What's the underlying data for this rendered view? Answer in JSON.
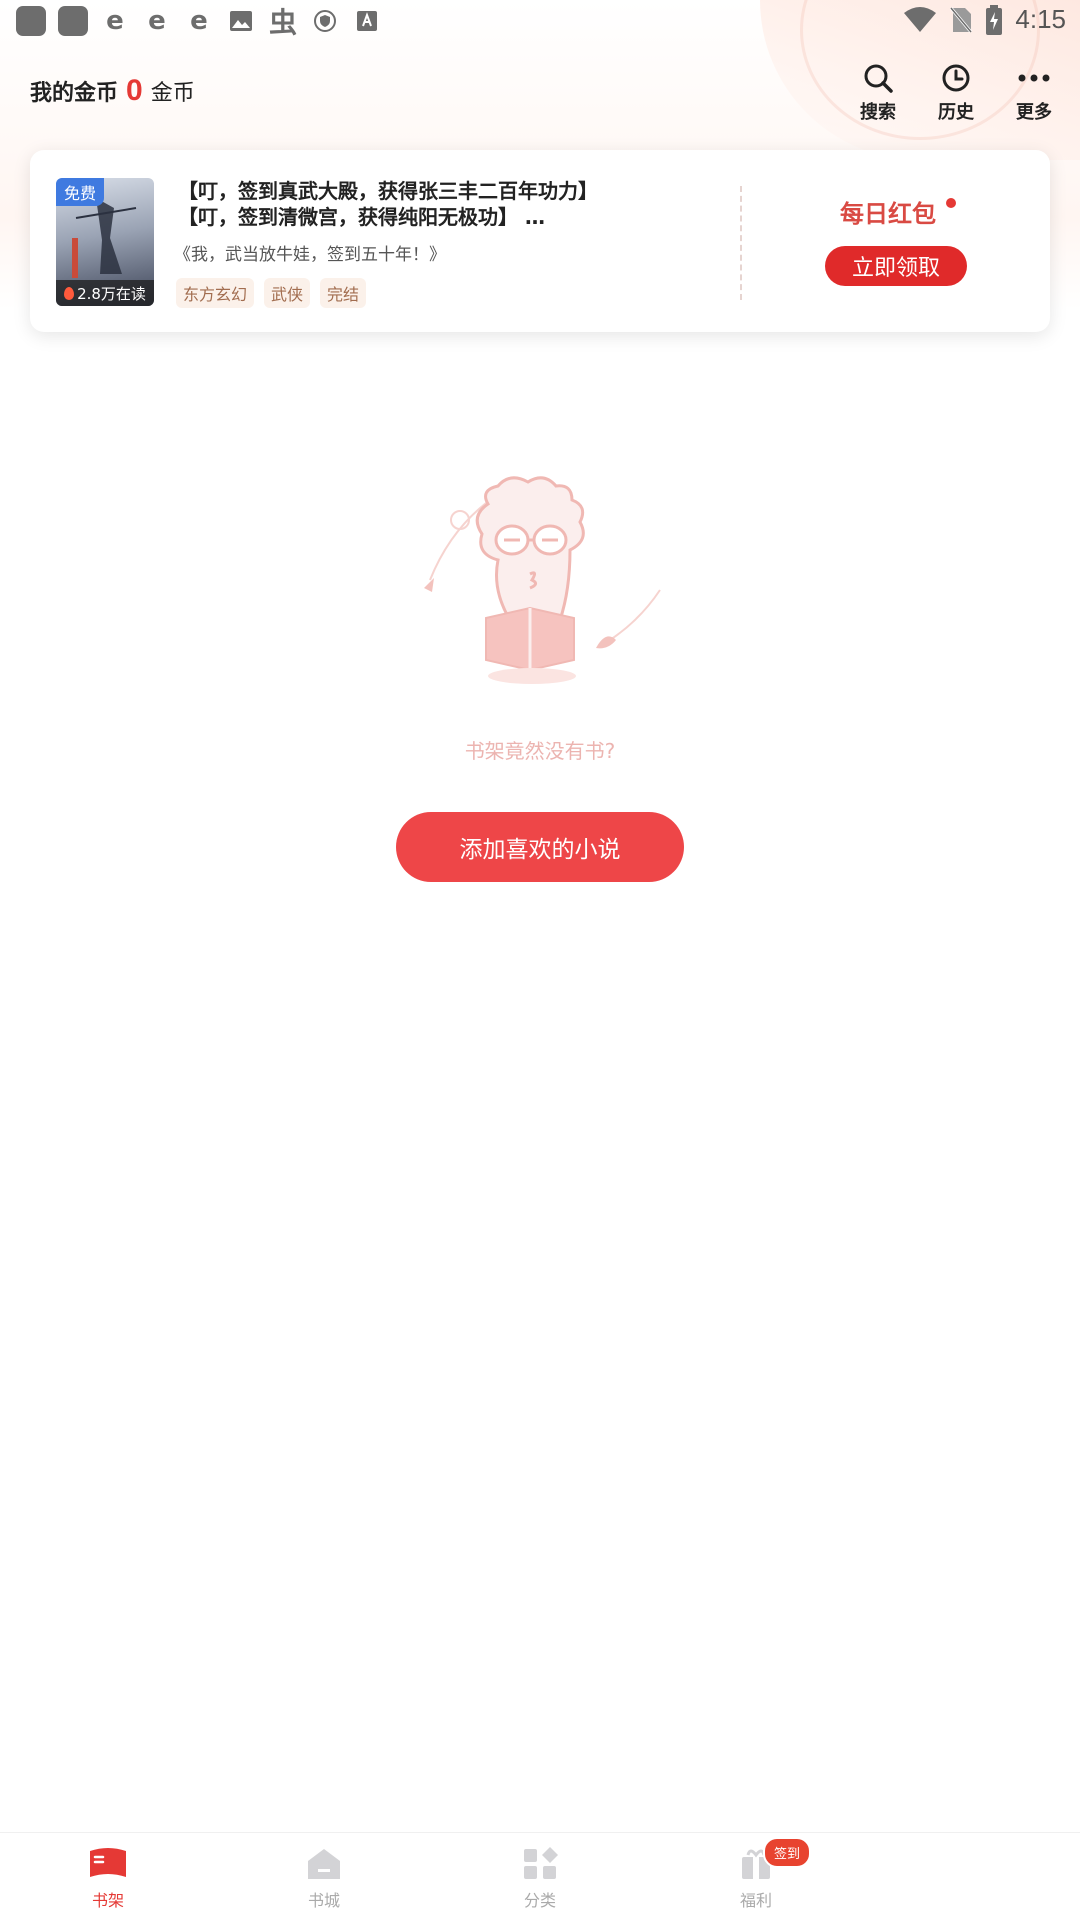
{
  "status_bar": {
    "time": "4:15"
  },
  "header": {
    "coins_label": "我的金币",
    "coins_value": "0",
    "coins_unit": "金币",
    "actions": [
      {
        "icon": "search-icon",
        "label": "搜索"
      },
      {
        "icon": "history-icon",
        "label": "历史"
      },
      {
        "icon": "more-icon",
        "label": "更多"
      }
    ]
  },
  "promo": {
    "free_tag": "免费",
    "readers": "2.8万在读",
    "title_line1": "【叮，签到真武大殿，获得张三丰二百年功力】",
    "title_line2": "【叮，签到清微宫，获得纯阳无极功】 …",
    "book_name": "《我，武当放牛娃，签到五十年！》",
    "tags": [
      "东方玄幻",
      "武侠",
      "完结"
    ],
    "red_packet_title": "每日红包",
    "red_packet_button": "立即领取"
  },
  "empty_state": {
    "message": "书架竟然没有书?",
    "button": "添加喜欢的小说"
  },
  "bottom_nav": {
    "items": [
      {
        "label": "书架",
        "icon": "bookshelf-icon",
        "active": true
      },
      {
        "label": "书城",
        "icon": "bookstore-icon",
        "active": false
      },
      {
        "label": "分类",
        "icon": "category-icon",
        "active": false
      },
      {
        "label": "福利",
        "icon": "gift-icon",
        "active": false
      }
    ],
    "checkin_badge": "签到"
  },
  "colors": {
    "accent": "#e53935",
    "button": "#ee4648",
    "empty_text": "#ecb4b0"
  }
}
